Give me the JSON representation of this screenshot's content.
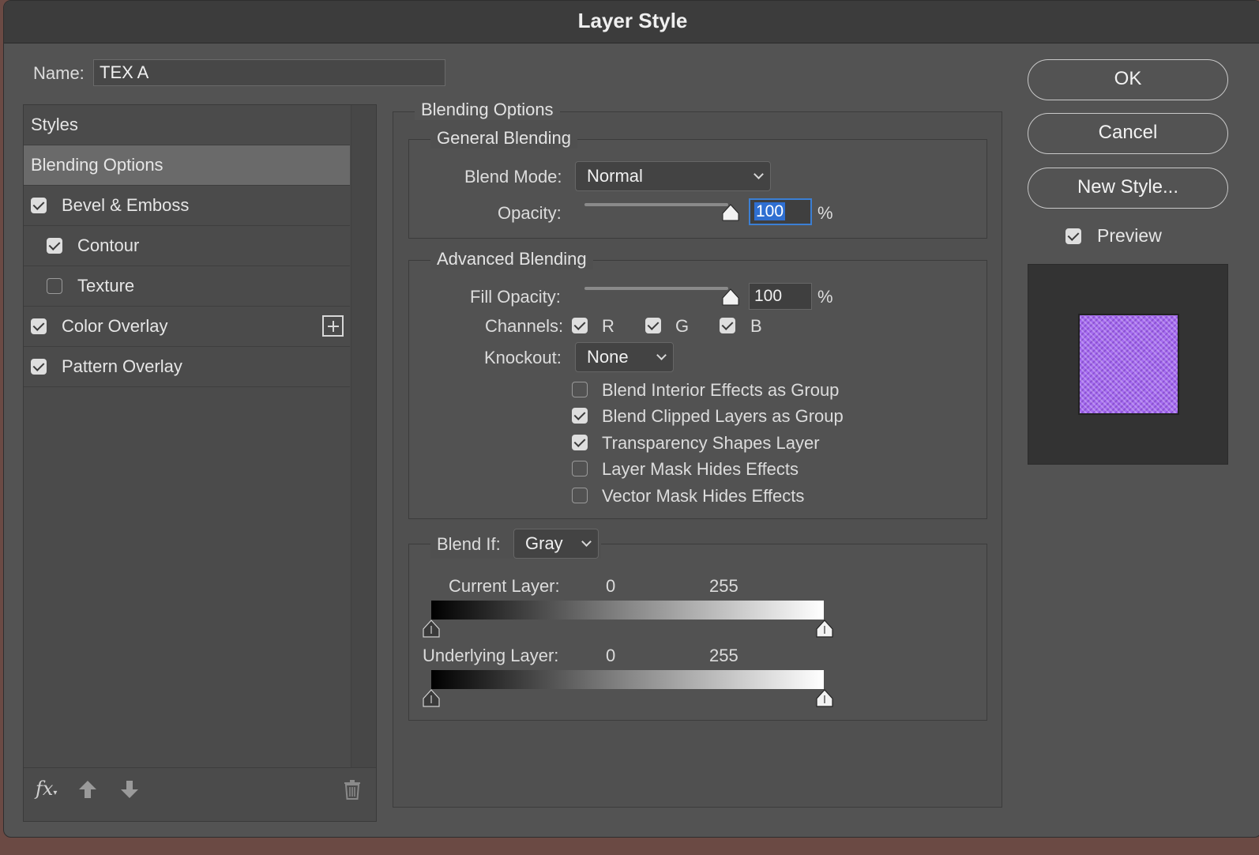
{
  "window": {
    "title": "Layer Style"
  },
  "name_field": {
    "label": "Name:",
    "value": "TEX A"
  },
  "styles_list": {
    "header": "Styles",
    "items": [
      {
        "label": "Blending Options",
        "selected": true,
        "checkbox": null
      },
      {
        "label": "Bevel & Emboss",
        "checkbox": true
      },
      {
        "label": "Contour",
        "checkbox": true
      },
      {
        "label": "Texture",
        "checkbox": false
      },
      {
        "label": "Color Overlay",
        "checkbox": true
      },
      {
        "label": "Pattern Overlay",
        "checkbox": true
      }
    ],
    "toolbar": {
      "fx_label": "fx"
    }
  },
  "blending_options": {
    "title": "Blending Options",
    "general": {
      "title": "General Blending",
      "blend_mode_label": "Blend Mode:",
      "blend_mode_value": "Normal",
      "opacity_label": "Opacity:",
      "opacity_value": "100",
      "percent": "%"
    },
    "advanced": {
      "title": "Advanced Blending",
      "fill_opacity_label": "Fill Opacity:",
      "fill_opacity_value": "100",
      "percent": "%",
      "channels_label": "Channels:",
      "channels": [
        {
          "label": "R",
          "checked": true
        },
        {
          "label": "G",
          "checked": true
        },
        {
          "label": "B",
          "checked": true
        }
      ],
      "knockout_label": "Knockout:",
      "knockout_value": "None",
      "options": [
        {
          "label": "Blend Interior Effects as Group",
          "checked": false
        },
        {
          "label": "Blend Clipped Layers as Group",
          "checked": true
        },
        {
          "label": "Transparency Shapes Layer",
          "checked": true
        },
        {
          "label": "Layer Mask Hides Effects",
          "checked": false
        },
        {
          "label": "Vector Mask Hides Effects",
          "checked": false
        }
      ]
    },
    "blend_if": {
      "label": "Blend If:",
      "value": "Gray",
      "current_layer": {
        "label": "Current Layer:",
        "min": "0",
        "max": "255"
      },
      "underlying_layer": {
        "label": "Underlying Layer:",
        "min": "0",
        "max": "255"
      }
    }
  },
  "buttons": {
    "ok": "OK",
    "cancel": "Cancel",
    "new_style": "New Style..."
  },
  "preview": {
    "label": "Preview",
    "checked": true,
    "swatch_color": "#a66cf0"
  }
}
